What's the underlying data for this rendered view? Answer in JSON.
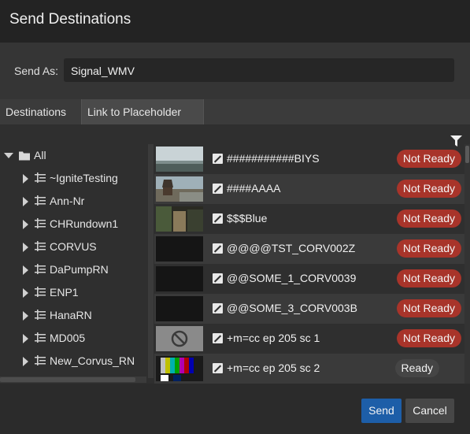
{
  "dialog": {
    "title": "Send Destinations"
  },
  "send_as": {
    "label": "Send As:",
    "value": "Signal_WMV"
  },
  "tabs": [
    {
      "label": "Destinations"
    },
    {
      "label": "Link to Placeholder"
    }
  ],
  "tree": {
    "root": {
      "label": "All"
    },
    "items": [
      {
        "label": "~IgniteTesting"
      },
      {
        "label": "Ann-Nr"
      },
      {
        "label": "CHRundown1"
      },
      {
        "label": "CORVUS"
      },
      {
        "label": "DaPumpRN"
      },
      {
        "label": "ENP1"
      },
      {
        "label": "HanaRN"
      },
      {
        "label": "MD005"
      },
      {
        "label": "New_Corvus_RN"
      }
    ]
  },
  "placeholders": [
    {
      "name": "###########BIYS",
      "status": "Not Ready"
    },
    {
      "name": "####AAAA",
      "status": "Not Ready"
    },
    {
      "name": "$$$Blue",
      "status": "Not Ready"
    },
    {
      "name": "@@@@TST_CORV002Z",
      "status": "Not Ready"
    },
    {
      "name": "@@SOME_1_CORV0039",
      "status": "Not Ready"
    },
    {
      "name": "@@SOME_3_CORV003B",
      "status": "Not Ready"
    },
    {
      "name": "+m=cc ep 205 sc 1",
      "status": "Not Ready"
    },
    {
      "name": "+m=cc ep 205 sc 2",
      "status": "Ready"
    }
  ],
  "footer": {
    "send_label": "Send",
    "cancel_label": "Cancel"
  },
  "colors": {
    "not_ready": "#a8342a",
    "ready": "#454545",
    "accent": "#1d5ea8"
  }
}
